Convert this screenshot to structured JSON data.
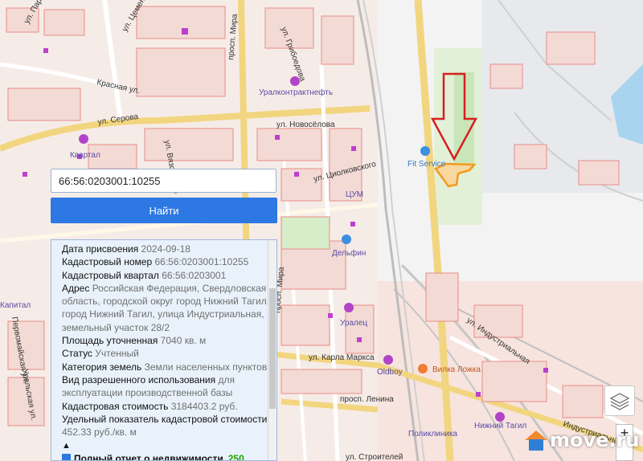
{
  "search": {
    "value": "66:56:0203001:10255"
  },
  "find_button": {
    "label": "Найти"
  },
  "info": {
    "rows": [
      {
        "key": "Дата присвоения",
        "value": "2024-09-18"
      },
      {
        "key": "Кадастровый номер",
        "value": "66:56:0203001:10255"
      },
      {
        "key": "Кадастровый квартал",
        "value": "66:56:0203001"
      },
      {
        "key": "Адрес",
        "value": "Российская Федерация, Свердловская область, городской округ город Нижний Тагил, город Нижний Тагил, улица Индустриальная, земельный участок 28/2"
      },
      {
        "key": "Площадь уточненная",
        "value": "7040 кв. м"
      },
      {
        "key": "Статус",
        "value": "Учтенный"
      },
      {
        "key": "Категория земель",
        "value": "Земли населенных пунктов"
      },
      {
        "key": "Вид разрешенного использования",
        "value": "для эксплуатации производственной базы"
      },
      {
        "key": "Кадастровая стоимость",
        "value": "3184403.2 руб."
      },
      {
        "key": "Удельный показатель кадастровой стоимости",
        "value": "452.33 руб./кв. м"
      }
    ],
    "collapse_glyph": "▲",
    "report_label": "Полный отчет о недвижимости",
    "report_price": "250"
  },
  "map_labels": {
    "streets": [
      "ул. Пархоменко",
      "ул. Серова",
      "ул. Новосёлова",
      "ул. Цементная",
      "ул. Грибоедова",
      "ул. Карла Маркса",
      "просп. Ленина",
      "ул. Циолковского",
      "ул. Вязовского",
      "просп. Мира",
      "ул. Индустриальная",
      "Индустриальная ул.",
      "ул. Строителей",
      "Красная ул.",
      "ул. Уральская",
      "Первомайская ул.",
      "Уральская ул."
    ],
    "pois": [
      "Уралконтрактнефть",
      "Fit Service",
      "ЦУМ",
      "Дельфин",
      "Уралец",
      "Oldboy",
      "Вилка Ложка",
      "Нижний Тагил",
      "Поликлиника",
      "Квартал",
      "Капитал"
    ]
  },
  "branding": {
    "logo_text": "move.ru"
  },
  "controls": {
    "layers_icon": "layers-icon",
    "zoom_in": "+"
  },
  "colors": {
    "accent": "#2d78e2",
    "plot_outline": "#f39a1c",
    "arrow": "#d61f1f",
    "price": "#21a000"
  }
}
